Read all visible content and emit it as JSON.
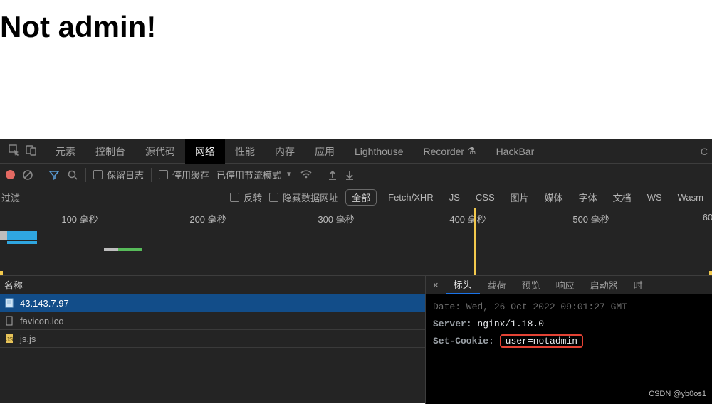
{
  "page": {
    "heading": "Not admin!"
  },
  "tabs": {
    "elements": "元素",
    "console": "控制台",
    "sources": "源代码",
    "network": "网络",
    "performance": "性能",
    "memory": "内存",
    "application": "应用",
    "lighthouse": "Lighthouse",
    "recorder": "Recorder",
    "hackbar": "HackBar"
  },
  "toolbar": {
    "preserve_log": "保留日志",
    "disable_cache": "停用缓存",
    "throttling_label": "已停用节流模式"
  },
  "filter": {
    "placeholder": "过滤",
    "invert": "反转",
    "hide_data_urls": "隐藏数据网址",
    "all": "全部",
    "types": [
      "Fetch/XHR",
      "JS",
      "CSS",
      "图片",
      "媒体",
      "字体",
      "文档",
      "WS",
      "Wasm"
    ]
  },
  "timeline": {
    "ticks": [
      "100 毫秒",
      "200 毫秒",
      "300 毫秒",
      "400 毫秒",
      "500 毫秒",
      "60"
    ]
  },
  "requests": {
    "column_name": "名称",
    "rows": [
      {
        "name": "43.143.7.97",
        "icon": "doc",
        "selected": true
      },
      {
        "name": "favicon.ico",
        "icon": "file",
        "selected": false
      },
      {
        "name": "js.js",
        "icon": "js",
        "selected": false
      }
    ]
  },
  "detail": {
    "tabs": {
      "headers": "标头",
      "payload": "载荷",
      "preview": "预览",
      "response": "响应",
      "initiator": "启动器",
      "timing": "时"
    },
    "date_line": "Date: Wed, 26 Oct 2022 09:01:27 GMT",
    "server_key": "Server:",
    "server_val": "nginx/1.18.0",
    "setcookie_key": "Set-Cookie:",
    "setcookie_val": "user=notadmin"
  },
  "watermark": "CSDN @yb0os1"
}
